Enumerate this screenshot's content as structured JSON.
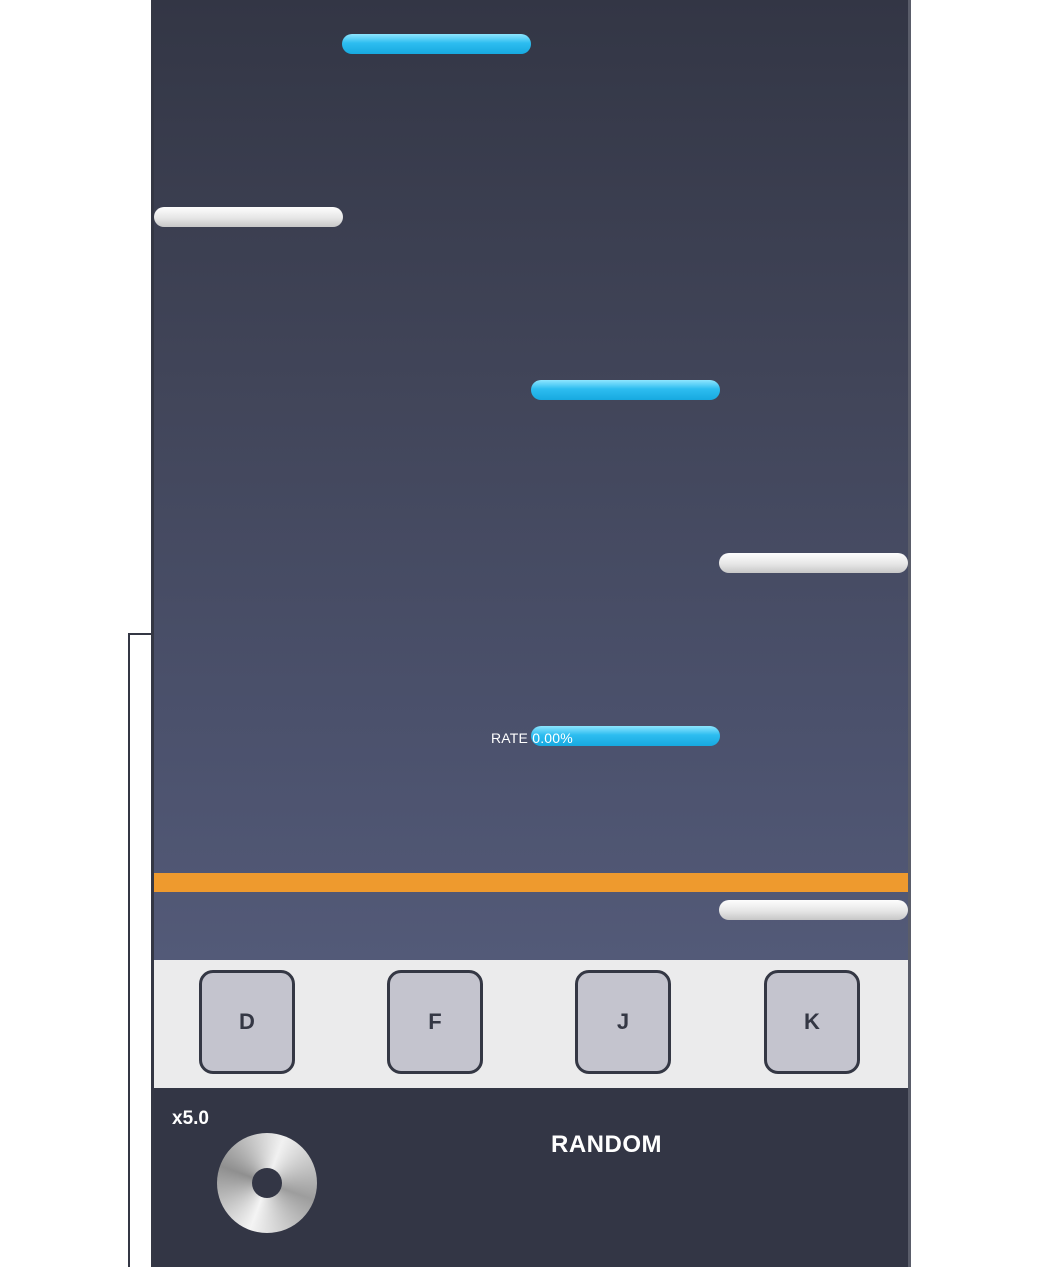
{
  "rate": {
    "label": "RATE",
    "value": "0.00%"
  },
  "keys": [
    "D",
    "F",
    "J",
    "K"
  ],
  "speed": "x5.0",
  "mode": "RANDOM",
  "colors": {
    "judge_line": "#ee9a2e",
    "note_blue": "#2dbdf0",
    "note_white": "#e6e6e6",
    "background": "#333645",
    "key_face": "#c4c4ce"
  },
  "notes": [
    {
      "lane": 2,
      "color": "blue"
    },
    {
      "lane": 1,
      "color": "white"
    },
    {
      "lane": 3,
      "color": "blue"
    },
    {
      "lane": 4,
      "color": "white"
    },
    {
      "lane": 3,
      "color": "blue"
    },
    {
      "lane": 4,
      "color": "white"
    }
  ]
}
